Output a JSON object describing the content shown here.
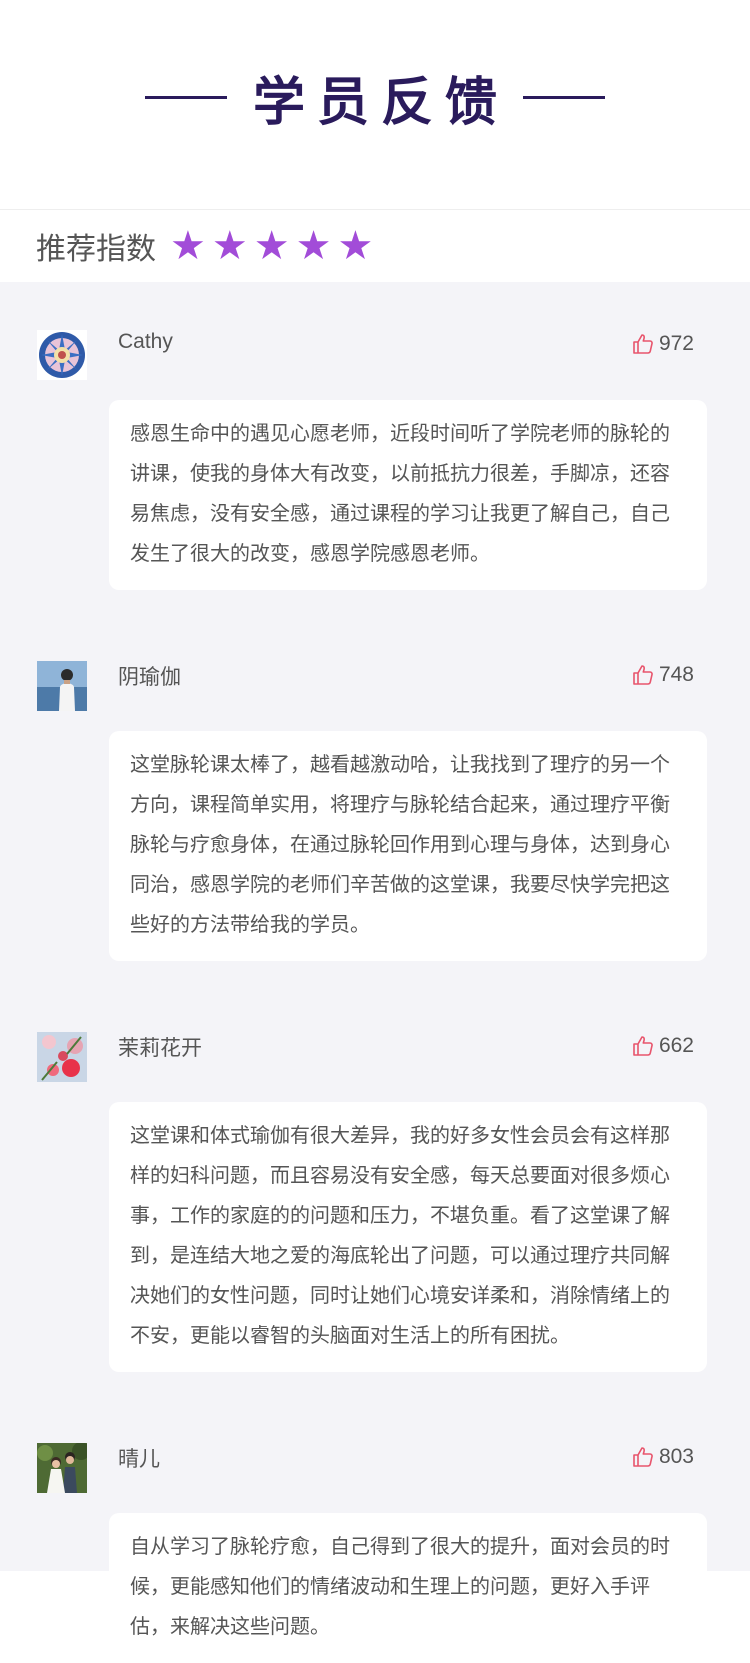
{
  "header": {
    "title": "学员反馈"
  },
  "rating": {
    "label": "推荐指数",
    "stars": 5,
    "max": 5,
    "color": "#a24cd8"
  },
  "reviews": [
    {
      "name": "Cathy",
      "likes": "972",
      "text": "感恩生命中的遇见心愿老师，近段时间听了学院老师的脉轮的讲课，使我的身体大有改变，以前抵抗力很差，手脚凉，还容易焦虑，没有安全感，通过课程的学习让我更了解自己，自己发生了很大的改变，感恩学院感恩老师。"
    },
    {
      "name": "阴瑜伽",
      "likes": "748",
      "text": "这堂脉轮课太棒了，越看越激动哈，让我找到了理疗的另一个方向，课程简单实用，将理疗与脉轮结合起来，通过理疗平衡脉轮与疗愈身体，在通过脉轮回作用到心理与身体，达到身心同治，感恩学院的老师们辛苦做的这堂课，我要尽快学完把这些好的方法带给我的学员。"
    },
    {
      "name": "茉莉花开",
      "likes": "662",
      "text": "这堂课和体式瑜伽有很大差异，我的好多女性会员会有这样那样的妇科问题，而且容易没有安全感，每天总要面对很多烦心事，工作的家庭的的问题和压力，不堪负重。看了这堂课了解到，是连结大地之爱的海底轮出了问题，可以通过理疗共同解决她们的女性问题，同时让她们心境安详柔和，消除情绪上的不安，更能以睿智的头脑面对生活上的所有困扰。"
    },
    {
      "name": "晴儿",
      "likes": "803",
      "text": "自从学习了脉轮疗愈，自己得到了很大的提升，面对会员的时候，更能感知他们的情绪波动和生理上的问题，更好入手评估，来解决这些问题。"
    }
  ]
}
